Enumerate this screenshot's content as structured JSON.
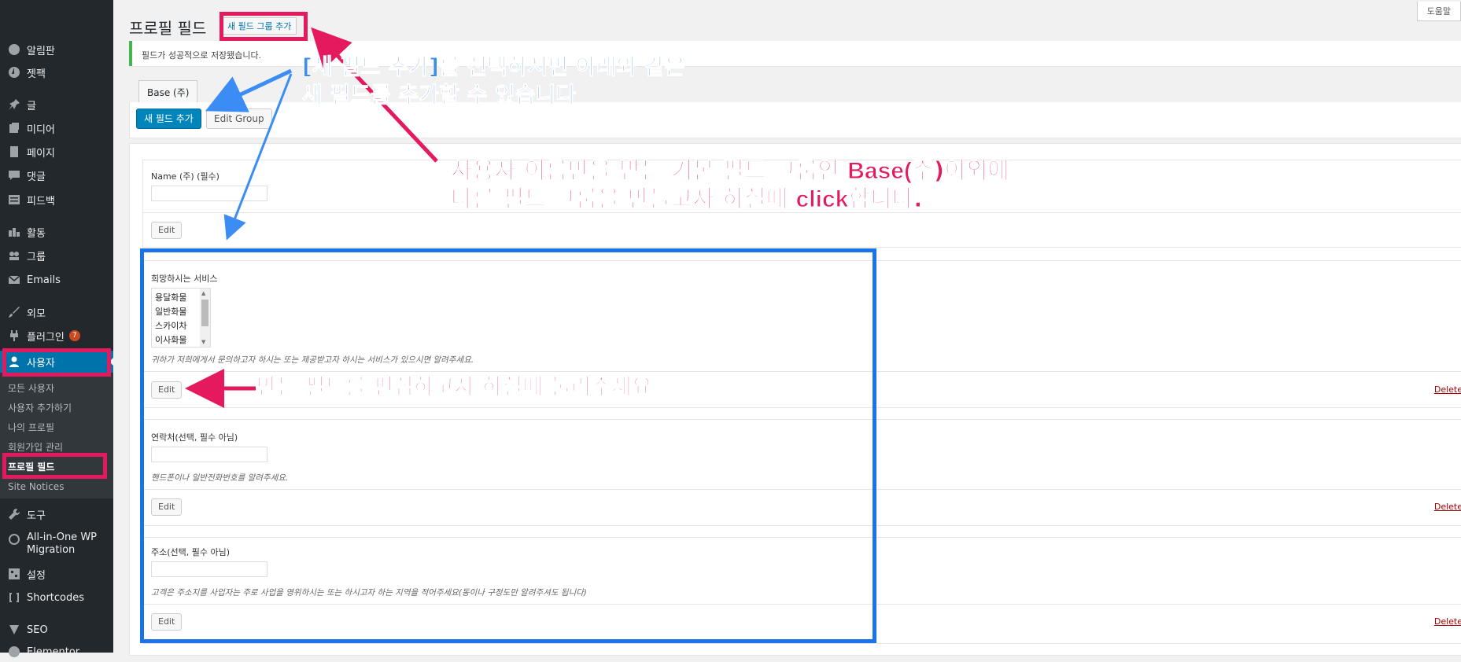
{
  "sidebar": {
    "menu": [
      {
        "label": "알림판",
        "icon": "dashboard-icon"
      },
      {
        "label": "젯팩",
        "icon": "jetpack-icon"
      },
      {
        "label": "글",
        "icon": "pin-icon"
      },
      {
        "label": "미디어",
        "icon": "media-icon"
      },
      {
        "label": "페이지",
        "icon": "page-icon"
      },
      {
        "label": "댓글",
        "icon": "comment-icon"
      },
      {
        "label": "피드백",
        "icon": "feedback-icon"
      },
      {
        "label": "활동",
        "icon": "activity-icon"
      },
      {
        "label": "그룹",
        "icon": "groups-icon"
      },
      {
        "label": "Emails",
        "icon": "email-icon"
      },
      {
        "label": "외모",
        "icon": "brush-icon"
      },
      {
        "label": "플러그인",
        "icon": "plugin-icon",
        "badge": "7"
      },
      {
        "label": "사용자",
        "icon": "user-icon"
      },
      {
        "label": "도구",
        "icon": "wrench-icon"
      },
      {
        "label": "All-in-One WP Migration",
        "icon": "migration-icon"
      },
      {
        "label": "설정",
        "icon": "settings-icon"
      },
      {
        "label": "Shortcodes",
        "icon": "shortcodes-icon"
      },
      {
        "label": "SEO",
        "icon": "seo-icon"
      },
      {
        "label": "Elementor",
        "icon": "elementor-icon"
      }
    ],
    "submenu": [
      "모든 사용자",
      "사용자 추가하기",
      "나의 프로필",
      "회원가입 관리",
      "프로필 필드",
      "Site Notices"
    ]
  },
  "header": {
    "title": "프로필 필드",
    "add_group_label": "새 필드 그룹 추가",
    "help_label": "도움말"
  },
  "notice": "필드가 성공적으로 저장됐습니다.",
  "tab_label": "Base (주)",
  "toolbar": {
    "add_field_label": "새 필드 추가",
    "edit_group_label": "Edit Group"
  },
  "fields": [
    {
      "label": "Name (주) (필수)",
      "edit": "Edit"
    },
    {
      "label": "희망하시는 서비스",
      "options": [
        "용달화물",
        "일반화물",
        "스카이차",
        "이사화물"
      ],
      "description": "귀하가 저희에게서 문의하고자 하시는 또는 제공받고자 하시는 서비스가 있으시면 알려주세요.",
      "edit": "Edit",
      "delete": "Delete"
    },
    {
      "label": "연락처(선택, 필수 아님)",
      "description": "핸드폰이나 일반전화번호를 알려주세요.",
      "edit": "Edit",
      "delete": "Delete"
    },
    {
      "label": "주소(선택, 필수 아님)",
      "description": "고객은 주소지를 사업자는 주로 사업을 영위하시는 또는 하시고자 하는 지역을 적어주세요(동이나 구정도만 알려주셔도 됩니다)",
      "edit": "Edit",
      "delete": "Delete"
    }
  ],
  "annotations": {
    "blue_line1": "[새 필드 추가]를 선택하시면 아래와 같은",
    "blue_line2": "새 필드를 추가할 수 있습니다",
    "red_line1_pre": "사용자 이름만을 받는 기본 필드 그룹인 ",
    "red_line1_bold": "Base(",
    "red_line1_mid": "주",
    "red_line1_post": ")이외에",
    "red_line2_pre": "다른 필드 그룹을 만들고자 하실때 ",
    "red_line2_bold": "click",
    "red_line2_post": "합니다.",
    "edit_note": "만든 필드를 편집하고자 하실때 눌러주세요"
  },
  "colors": {
    "sidebar_bg": "#23282d",
    "active": "#0073aa",
    "annotation_red": "#e5195e",
    "annotation_blue": "#1a73e8",
    "notice_green": "#46b450"
  }
}
